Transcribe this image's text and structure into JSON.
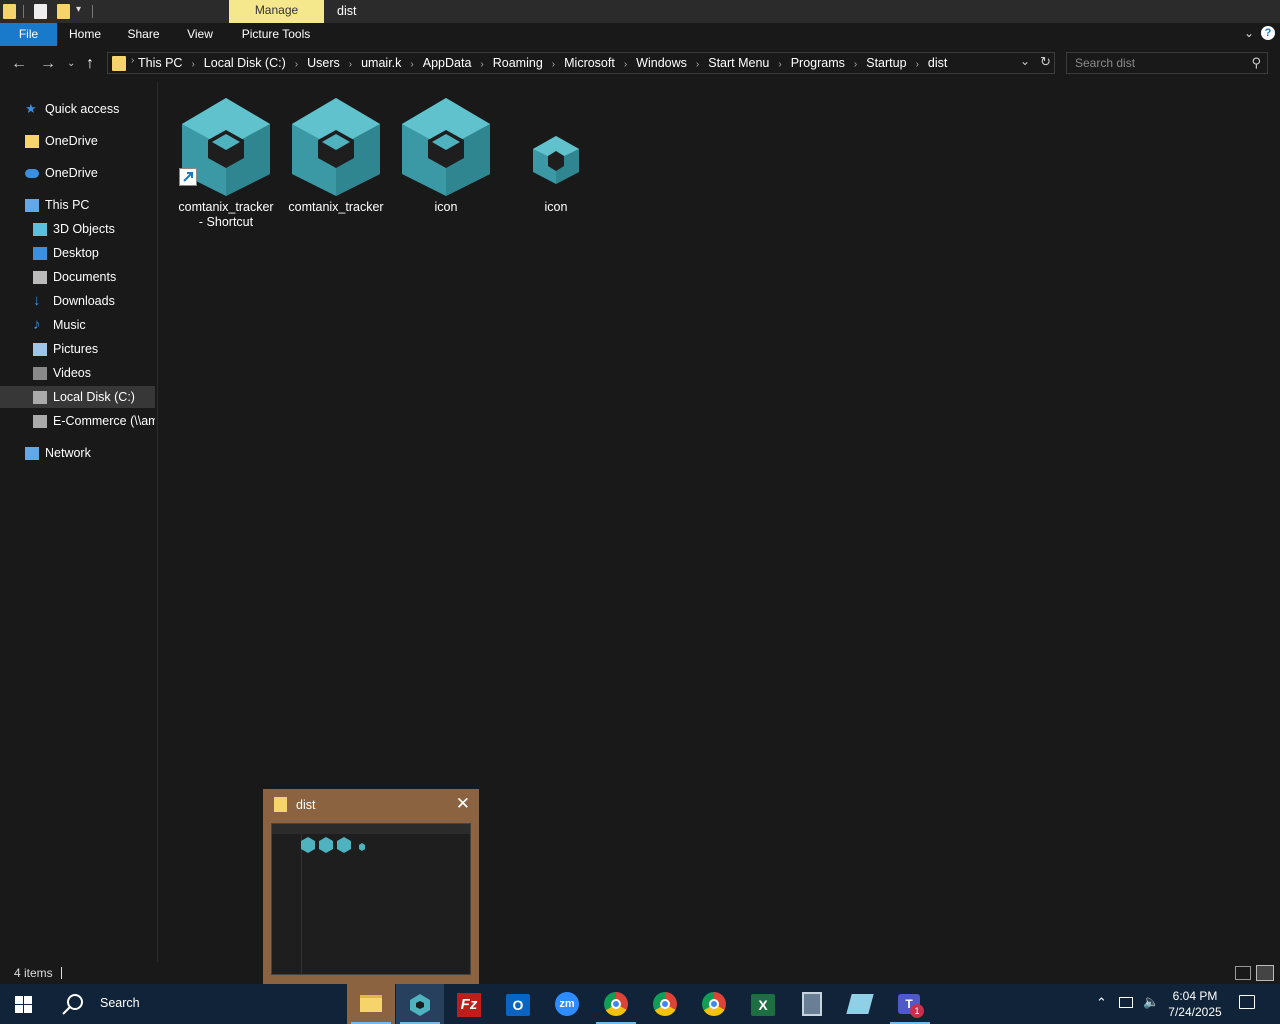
{
  "window": {
    "title": "dist",
    "manage_tab": "Manage"
  },
  "ribbon": {
    "tabs": [
      "File",
      "Home",
      "Share",
      "View",
      "Picture Tools"
    ]
  },
  "address": {
    "breadcrumbs": [
      "This PC",
      "Local Disk (C:)",
      "Users",
      "umair.k",
      "AppData",
      "Roaming",
      "Microsoft",
      "Windows",
      "Start Menu",
      "Programs",
      "Startup",
      "dist"
    ]
  },
  "search": {
    "placeholder": "Search dist"
  },
  "navpane": {
    "items": [
      {
        "label": "Quick access",
        "icon": "star-icon"
      },
      {
        "label": "OneDrive",
        "icon": "folder-icon"
      },
      {
        "label": "OneDrive",
        "icon": "cloud-icon"
      },
      {
        "label": "This PC",
        "icon": "computer-icon"
      },
      {
        "label": "3D Objects",
        "icon": "cube-icon"
      },
      {
        "label": "Desktop",
        "icon": "desktop-icon"
      },
      {
        "label": "Documents",
        "icon": "document-icon"
      },
      {
        "label": "Downloads",
        "icon": "download-icon"
      },
      {
        "label": "Music",
        "icon": "music-icon"
      },
      {
        "label": "Pictures",
        "icon": "pictures-icon"
      },
      {
        "label": "Videos",
        "icon": "video-icon"
      },
      {
        "label": "Local Disk (C:)",
        "icon": "drive-icon",
        "selected": true
      },
      {
        "label": "E-Commerce (\\\\am",
        "icon": "network-drive-icon"
      },
      {
        "label": "Network",
        "icon": "network-icon"
      }
    ]
  },
  "files": [
    {
      "label": "comtanix_tracker - Shortcut",
      "line1": "comtanix_tracker",
      "line2": "- Shortcut",
      "shortcut": true
    },
    {
      "label": "comtanix_tracker",
      "line1": "comtanix_tracker",
      "line2": ""
    },
    {
      "label": "icon",
      "line1": "icon",
      "line2": ""
    },
    {
      "label": "icon",
      "line1": "icon",
      "line2": "",
      "small": true
    }
  ],
  "status": {
    "count": "4 items"
  },
  "preview": {
    "title": "dist"
  },
  "taskbar": {
    "search_label": "Search",
    "time": "6:04 PM",
    "date": "7/24/2025",
    "teams_badge": "1"
  },
  "colors": {
    "accent": "#1979ca",
    "manage_tab": "#f5e88c",
    "icon_teal": "#4fb3bf",
    "taskbar": "#102339",
    "preview_frame": "#8b6340"
  }
}
